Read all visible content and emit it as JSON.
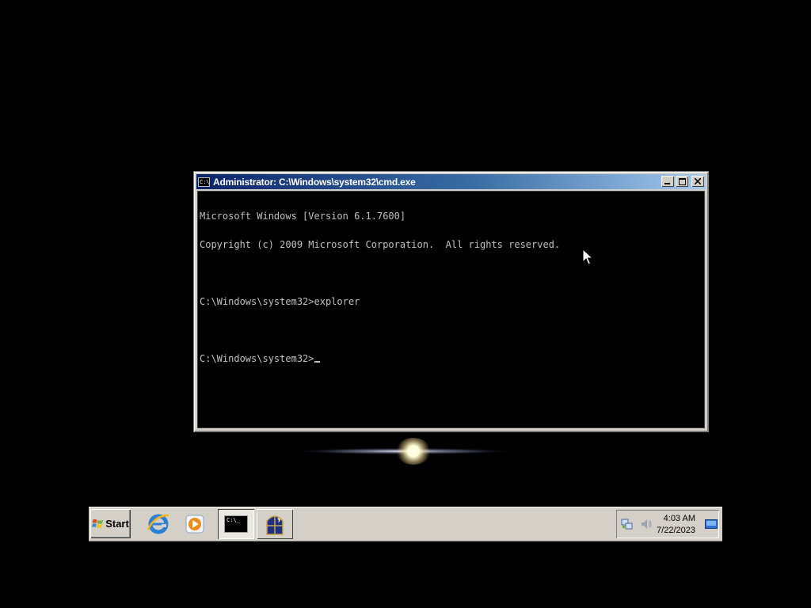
{
  "window": {
    "title": "Administrator: C:\\Windows\\system32\\cmd.exe",
    "icon_label": "C:\\",
    "buttons": [
      "minimize",
      "maximize",
      "close"
    ]
  },
  "console": {
    "lines": [
      "Microsoft Windows [Version 6.1.7600]",
      "Copyright (c) 2009 Microsoft Corporation.  All rights reserved.",
      "",
      "C:\\Windows\\system32>explorer",
      "",
      "C:\\Windows\\system32>"
    ]
  },
  "taskbar": {
    "start_label": "Start",
    "quick_launch": [
      "internet-explorer-icon",
      "media-player-icon"
    ],
    "tasks": [
      {
        "name": "cmd",
        "label": "C:\\_",
        "active": true
      },
      {
        "name": "night-app",
        "active": false
      }
    ],
    "clock": {
      "time": "4:03 AM",
      "date": "7/22/2023"
    }
  },
  "colors": {
    "desktop": "#000000",
    "titlebar_start": "#0a246a",
    "titlebar_end": "#a6caf0",
    "console_text": "#c0c0c0",
    "taskbar": "#d4d0c8"
  }
}
